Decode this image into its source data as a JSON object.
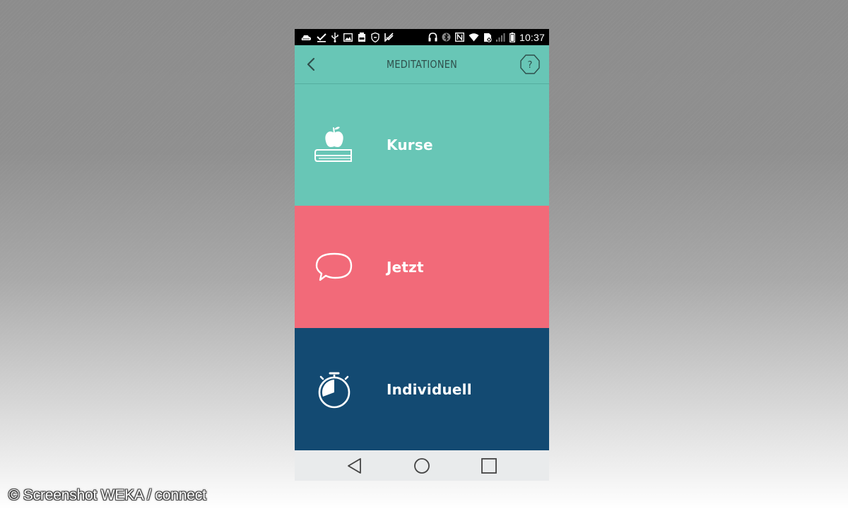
{
  "status_bar": {
    "time": "10:37",
    "left_icons": [
      "cloud-icon",
      "download-done-icon",
      "usb-icon",
      "image-icon",
      "battery-saver-icon",
      "shield-icon",
      "check-mark-icon"
    ],
    "right_icons": [
      "headset-icon",
      "bluetooth-icon",
      "nfc-icon",
      "wifi-icon",
      "no-sim-icon",
      "signal-icon",
      "battery-icon"
    ]
  },
  "header": {
    "title": "MEDITATIONEN",
    "back_icon": "chevron-left-icon",
    "help_label": "?"
  },
  "tiles": [
    {
      "label": "Kurse",
      "icon": "book-apple-icon",
      "color": "#68c6b6"
    },
    {
      "label": "Jetzt",
      "icon": "speech-bubble-icon",
      "color": "#f26a79"
    },
    {
      "label": "Individuell",
      "icon": "stopwatch-icon",
      "color": "#134a72"
    }
  ],
  "nav_bar": {
    "icons": [
      "nav-back-icon",
      "nav-home-icon",
      "nav-recents-icon"
    ]
  },
  "watermark": "© Screenshot WEKA / connect",
  "colors": {
    "header_bg": "#68c6b6",
    "header_text": "#2f4f4b",
    "nav_bg": "#e9ebec"
  }
}
